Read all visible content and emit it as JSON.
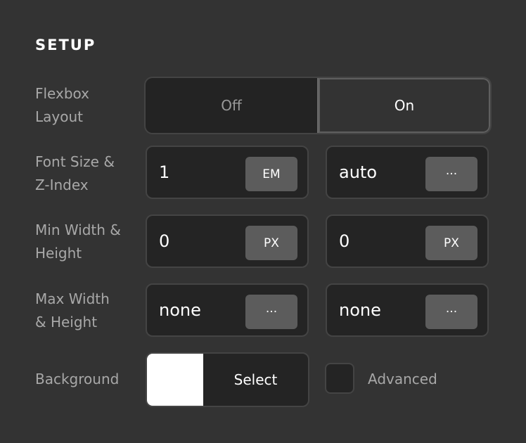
{
  "section_title": "SETUP",
  "flexbox": {
    "label_line1": "Flexbox",
    "label_line2": "Layout",
    "options": [
      "Off",
      "On"
    ],
    "selected": "On"
  },
  "font_size_z": {
    "label_line1": "Font Size &",
    "label_line2": "Z-Index",
    "font_size": {
      "value": "1",
      "unit": "EM"
    },
    "z_index": {
      "value": "auto",
      "unit": "···"
    }
  },
  "min_size": {
    "label_line1": "Min Width &",
    "label_line2": "Height",
    "width": {
      "value": "0",
      "unit": "PX"
    },
    "height": {
      "value": "0",
      "unit": "PX"
    }
  },
  "max_size": {
    "label_line1": "Max Width",
    "label_line2": "& Height",
    "width": {
      "value": "none",
      "unit": "···"
    },
    "height": {
      "value": "none",
      "unit": "···"
    }
  },
  "background": {
    "label": "Background",
    "color": "#ffffff",
    "select_label": "Select"
  },
  "advanced": {
    "label": "Advanced",
    "checked": false
  }
}
